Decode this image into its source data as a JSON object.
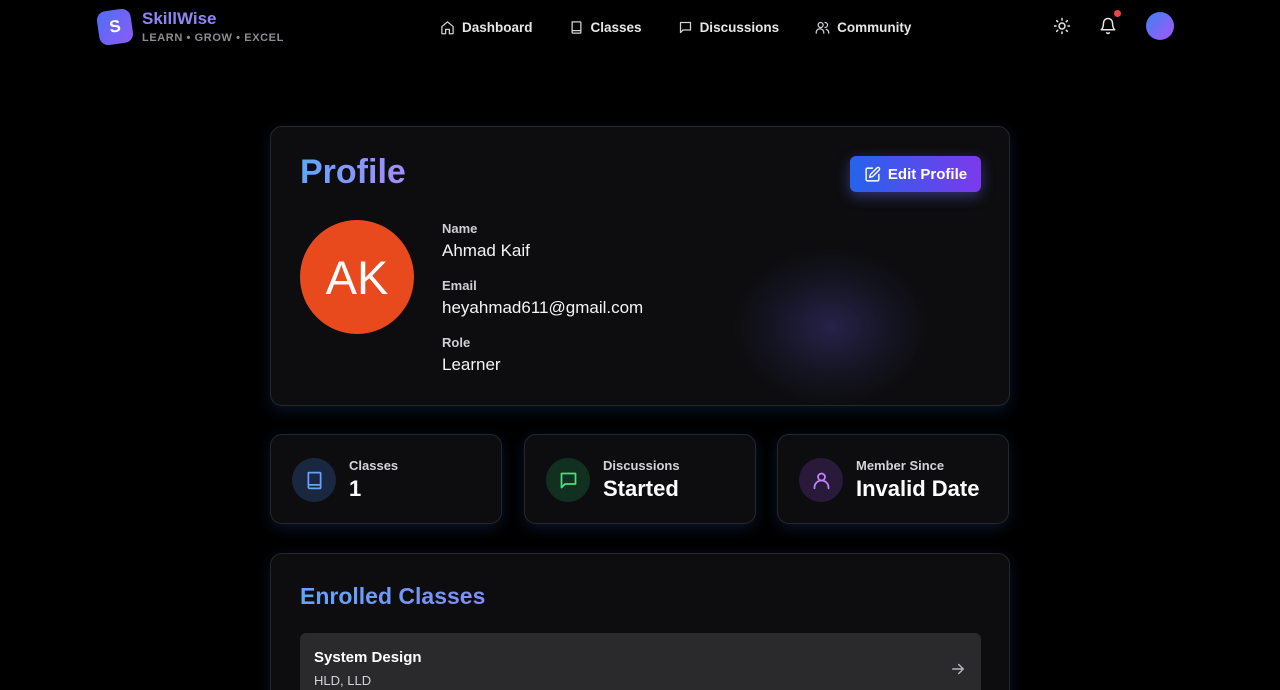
{
  "brand": {
    "logo_letter": "S",
    "name": "SkillWise",
    "tagline": "LEARN • GROW • EXCEL"
  },
  "nav": {
    "links": [
      {
        "label": "Dashboard",
        "icon": "home-icon"
      },
      {
        "label": "Classes",
        "icon": "book-icon"
      },
      {
        "label": "Discussions",
        "icon": "message-icon"
      },
      {
        "label": "Community",
        "icon": "users-icon"
      }
    ],
    "right_icons": [
      "sun-icon",
      "bell-icon",
      "avatar"
    ],
    "notification_dot_color": "#ef4444"
  },
  "profile": {
    "title": "Profile",
    "edit_label": "Edit Profile",
    "initials": "AK",
    "avatar_color": "#e8491d",
    "fields": [
      {
        "label": "Name",
        "value": "Ahmad Kaif"
      },
      {
        "label": "Email",
        "value": "heyahmad611@gmail.com"
      },
      {
        "label": "Role",
        "value": "Learner"
      }
    ]
  },
  "stats": [
    {
      "label": "Classes",
      "value": "1",
      "icon": "book-icon",
      "color": "#60a5fa"
    },
    {
      "label": "Discussions",
      "value": "Started",
      "icon": "message-icon",
      "color": "#4ade80"
    },
    {
      "label": "Member Since",
      "value": "Invalid Date",
      "icon": "user-icon",
      "color": "#c084fc"
    }
  ],
  "enrolled": {
    "title": "Enrolled Classes",
    "classes": [
      {
        "name": "System Design",
        "tags": "HLD, LLD"
      }
    ]
  },
  "colors": {
    "accent_blue": "#2563eb",
    "accent_purple": "#7c3aed",
    "background": "#000000",
    "card": "#0d0d0f"
  }
}
